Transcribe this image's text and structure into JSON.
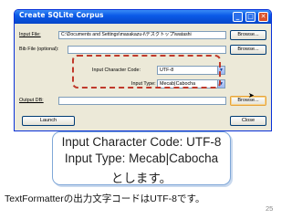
{
  "window": {
    "title": "Create SQLite Corpus",
    "min_label": "_",
    "max_label": "□",
    "close_label": "✕"
  },
  "form": {
    "input_file_label": "Input File:",
    "input_file_value": "C:\\Documents and Settings\\masakazu-i\\デスクトップ\\watashi",
    "bib_file_label": "Bib File (optional):",
    "bib_file_value": "",
    "char_code_label": "Input Character Code:",
    "char_code_value": "UTF-8",
    "input_type_label": "Input Type:",
    "input_type_value": "Mecab|Cabocha",
    "output_db_label": "Output DB:",
    "output_db_value": "",
    "browse_label": "Browse...",
    "launch_label": "Launch",
    "close_label": "Close"
  },
  "callout": {
    "line1": "Input Character Code: UTF-8",
    "line2": "Input Type: Mecab|Cabocha",
    "line3": "とします。"
  },
  "note": "TextFormatterの出力文字コードはUTF-8です。",
  "page_number": "25",
  "colors": {
    "title_bar": "#0a5ae8",
    "highlight_dash": "#c0392b",
    "callout_border": "#7fa7d8"
  }
}
